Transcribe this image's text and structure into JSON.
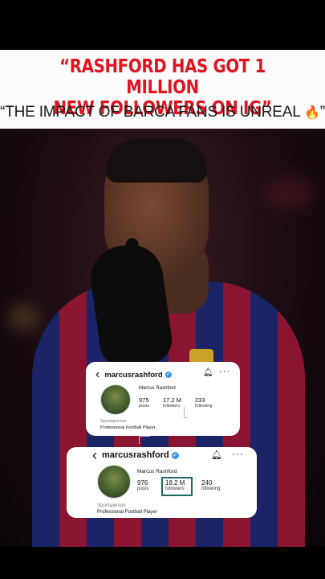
{
  "banner": {
    "headline_line1": "“RASHFORD HAS GOT 1 MILLION",
    "headline_line2": "NEW FOLLOWERS ON IG”",
    "subline": "“THE IMPACT OF BARCA FANS IS UNREAL",
    "subline_end": "”",
    "fire_emoji": "🔥"
  },
  "colors": {
    "headline": "#e0141e",
    "verified": "#3897f0",
    "highlight_box": "#1f6b63"
  },
  "profile_before": {
    "username": "marcusrashford",
    "display_name": "Marcus Rashford",
    "posts": "975",
    "posts_label": "posts",
    "followers": "17.2 M",
    "followers_label": "followers",
    "following": "233",
    "following_label": "following",
    "category": "Sportsperson",
    "bio": "Professional Football Player"
  },
  "profile_after": {
    "username": "marcusrashford",
    "display_name": "Marcus Rashford",
    "posts": "976",
    "posts_label": "posts",
    "followers": "18.2 M",
    "followers_label": "followers",
    "following": "240",
    "following_label": "following",
    "category": "Sportsperson",
    "bio": "Professional Football Player"
  },
  "icons": {
    "back": "chevron-left-icon",
    "verified": "verified-badge-icon",
    "bell": "bell-icon",
    "more": "more-icon"
  }
}
